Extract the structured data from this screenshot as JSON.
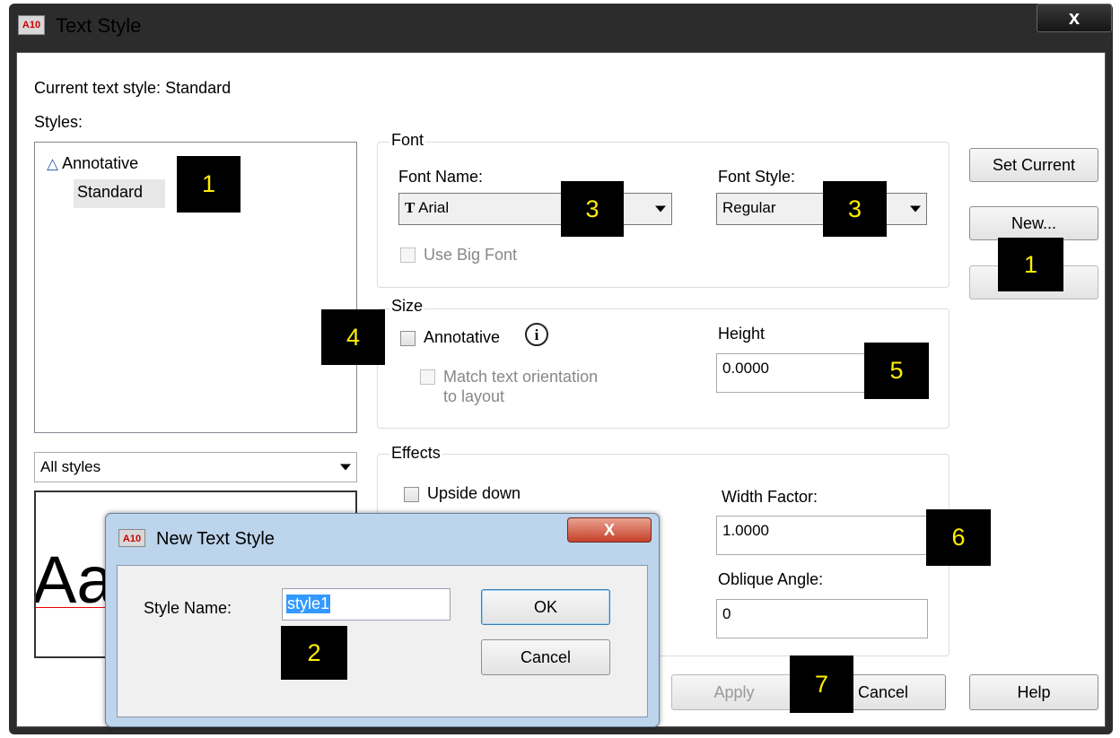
{
  "window": {
    "title": "Text Style",
    "close_label": "x"
  },
  "current_style": {
    "label": "Current text style:",
    "value": "Standard"
  },
  "styles": {
    "label": "Styles:",
    "items": [
      "Annotative",
      "Standard"
    ],
    "filter": "All styles"
  },
  "preview": {
    "text": "Aa"
  },
  "font": {
    "group_label": "Font",
    "name_label": "Font Name:",
    "name_value": "Arial",
    "style_label": "Font Style:",
    "style_value": "Regular",
    "big_font_label": "Use Big Font"
  },
  "size": {
    "group_label": "Size",
    "annotative_label": "Annotative",
    "match_label_1": "Match text orientation",
    "match_label_2": "to layout",
    "height_label": "Height",
    "height_value": "0.0000"
  },
  "effects": {
    "group_label": "Effects",
    "upside_label": "Upside down",
    "width_label": "Width Factor:",
    "width_value": "1.0000",
    "oblique_label": "Oblique Angle:",
    "oblique_value": "0"
  },
  "buttons": {
    "set_current": "Set Current",
    "new": "New...",
    "apply": "Apply",
    "cancel": "Cancel",
    "help": "Help"
  },
  "new_dialog": {
    "title": "New Text Style",
    "close_label": "X",
    "field_label": "Style Name:",
    "field_value": "style1",
    "ok": "OK",
    "cancel": "Cancel"
  },
  "annotations": [
    "1",
    "1",
    "2",
    "3",
    "3",
    "4",
    "5",
    "6",
    "7"
  ],
  "colors": {
    "badge_bg": "#000000",
    "badge_text": "#ffef00",
    "selection": "#3399ff"
  }
}
